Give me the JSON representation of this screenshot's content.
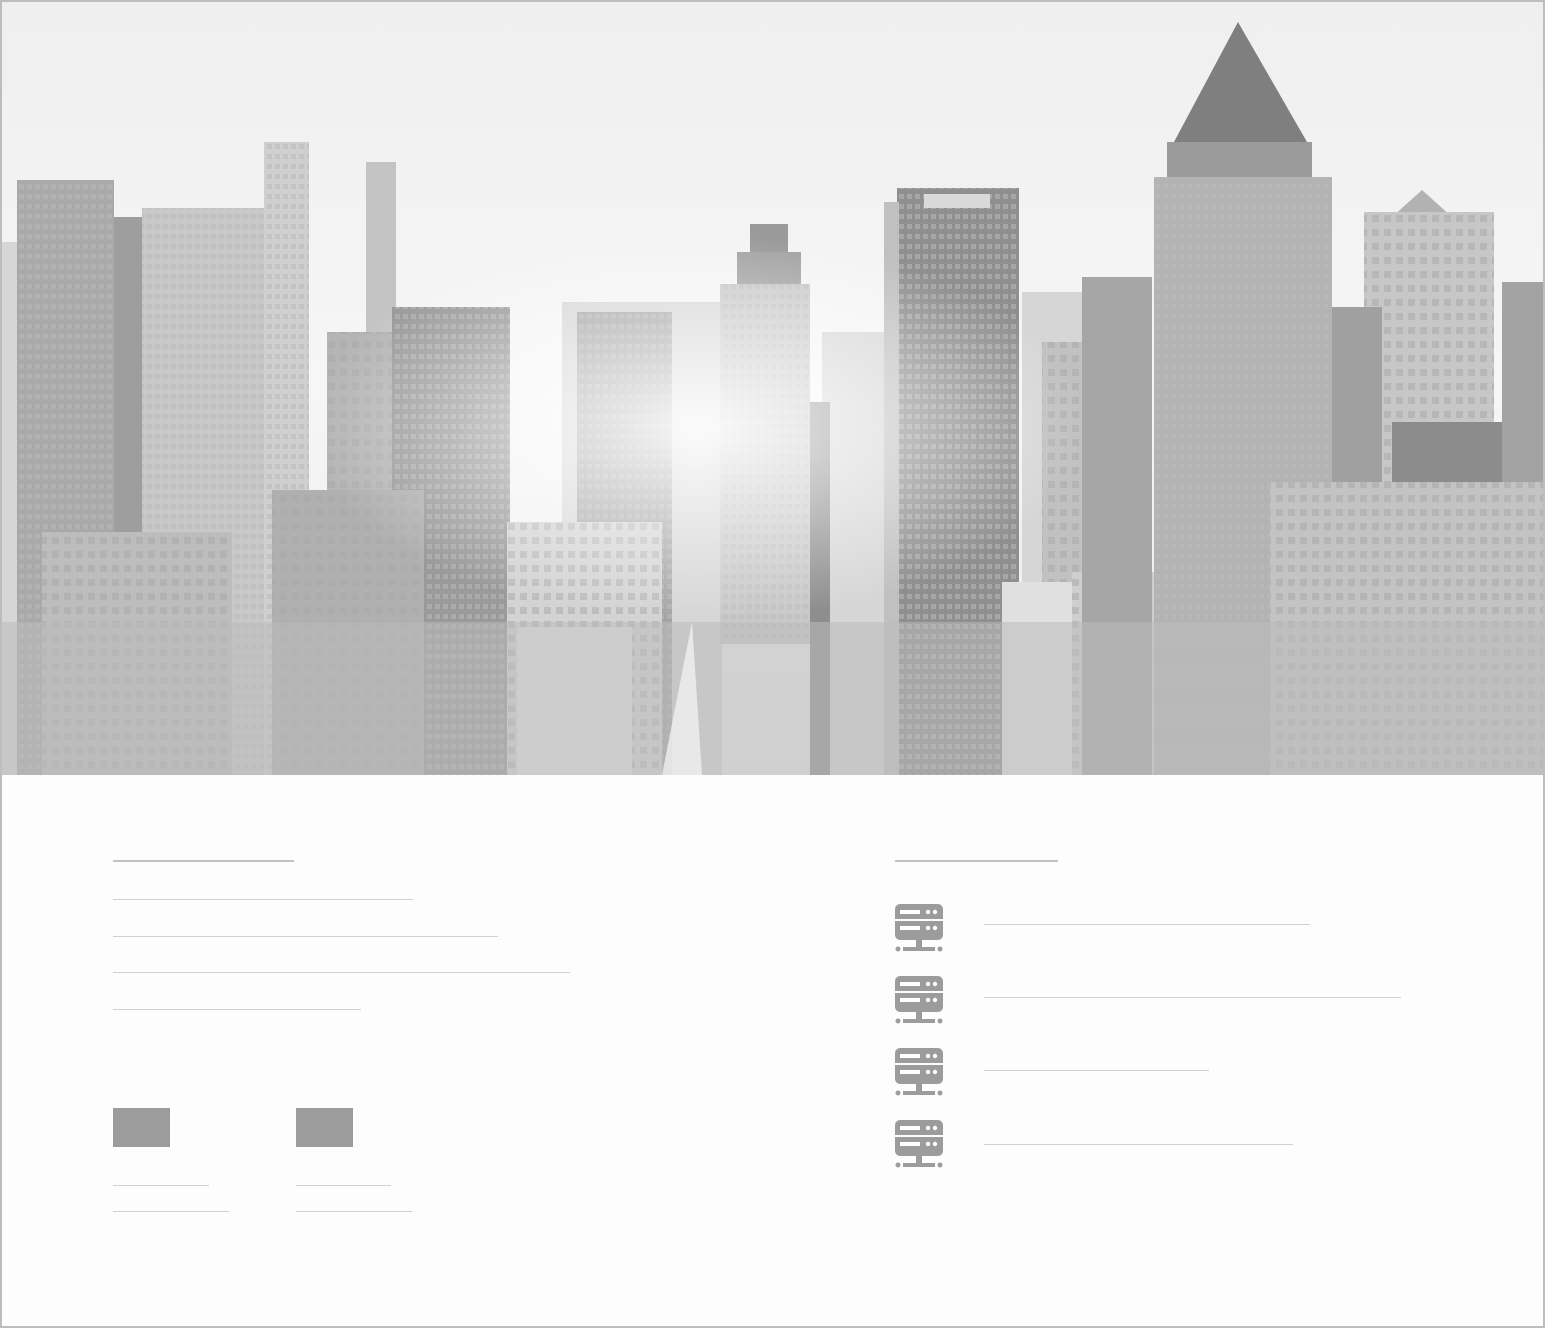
{
  "hero": {
    "icon": "city-skyline-image"
  },
  "left_section": {
    "heading": "",
    "lines": [
      "",
      "",
      "",
      ""
    ],
    "stats": [
      {
        "icon": "stat-block",
        "label": "",
        "sublabel": ""
      },
      {
        "icon": "stat-block",
        "label": "",
        "sublabel": ""
      }
    ]
  },
  "right_section": {
    "heading": "",
    "items": [
      {
        "icon": "server-icon",
        "label": ""
      },
      {
        "icon": "server-icon",
        "label": ""
      },
      {
        "icon": "server-icon",
        "label": ""
      },
      {
        "icon": "server-icon",
        "label": ""
      }
    ]
  },
  "colors": {
    "page_background": "#fdfdfd",
    "border": "#bdbdbd",
    "placeholder_line": "#d0d0d0",
    "icon_gray": "#9c9c9c"
  }
}
